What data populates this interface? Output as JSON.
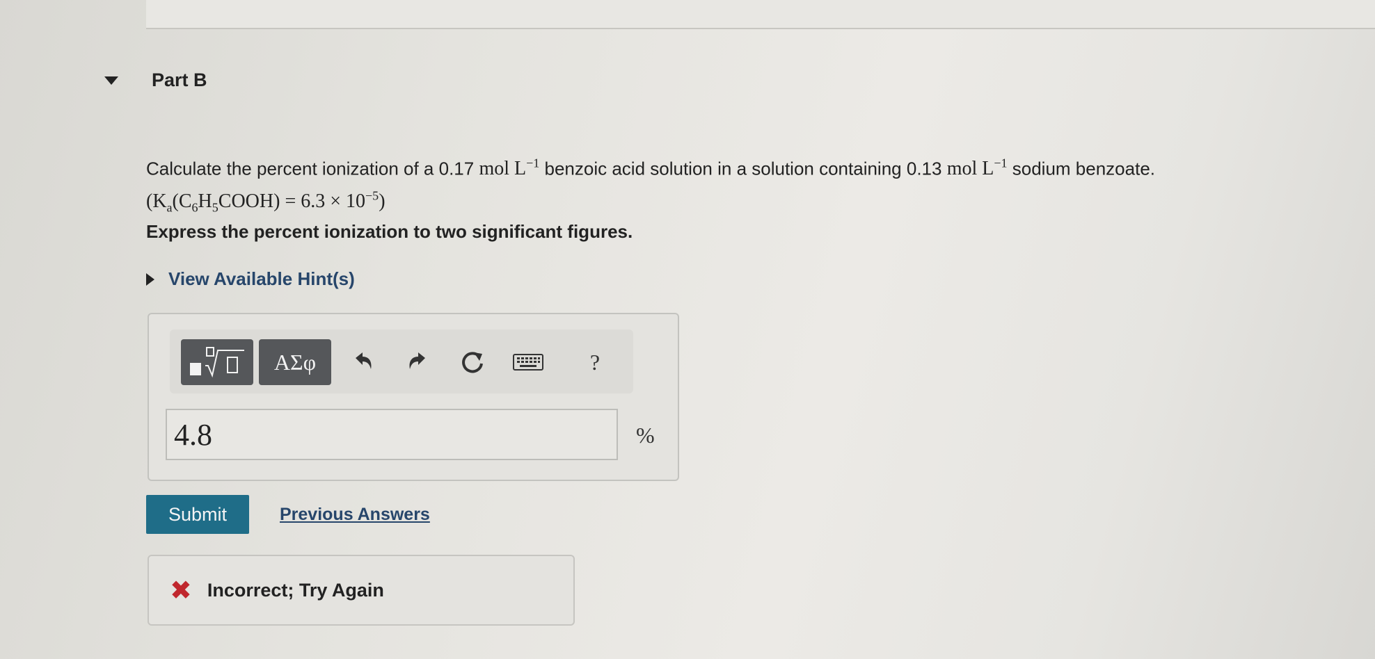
{
  "part": {
    "caret_icon": "caret-down-icon",
    "title": "Part B"
  },
  "question": {
    "lead": "Calculate the percent ionization of a ",
    "acid_conc": "0.17",
    "unit_mol": "mol L",
    "exp_neg1": "−1",
    "mid": " benzoic acid solution in a solution containing ",
    "salt_conc": "0.13",
    "tail": " sodium benzoate.",
    "ka_open": "(K",
    "ka_sub": "a",
    "c": "(C",
    "c_sub": "6",
    "h": "H",
    "h_sub": "5",
    "cooh": "COOH) = 6.3 × 10",
    "ka_exp": "−5",
    "close": ")"
  },
  "instruction": "Express the percent ionization to two significant figures.",
  "hint": {
    "caret_icon": "caret-right-icon",
    "label": "View Available Hint(s)"
  },
  "toolbar": {
    "greek_label": "ΑΣφ",
    "help_label": "?",
    "icons": [
      "templates-icon",
      "greek-icon",
      "undo-icon",
      "redo-icon",
      "reset-icon",
      "keyboard-icon",
      "help-icon"
    ]
  },
  "answer": {
    "value": "4.8",
    "unit": "%"
  },
  "actions": {
    "submit_label": "Submit",
    "previous_answers_label": "Previous Answers"
  },
  "feedback": {
    "icon": "x-icon",
    "text": "Incorrect; Try Again",
    "color": "#c0272d"
  },
  "colors": {
    "submit_bg": "#1f6d88",
    "link": "#27466b",
    "toolbar_button": "#55575a"
  }
}
